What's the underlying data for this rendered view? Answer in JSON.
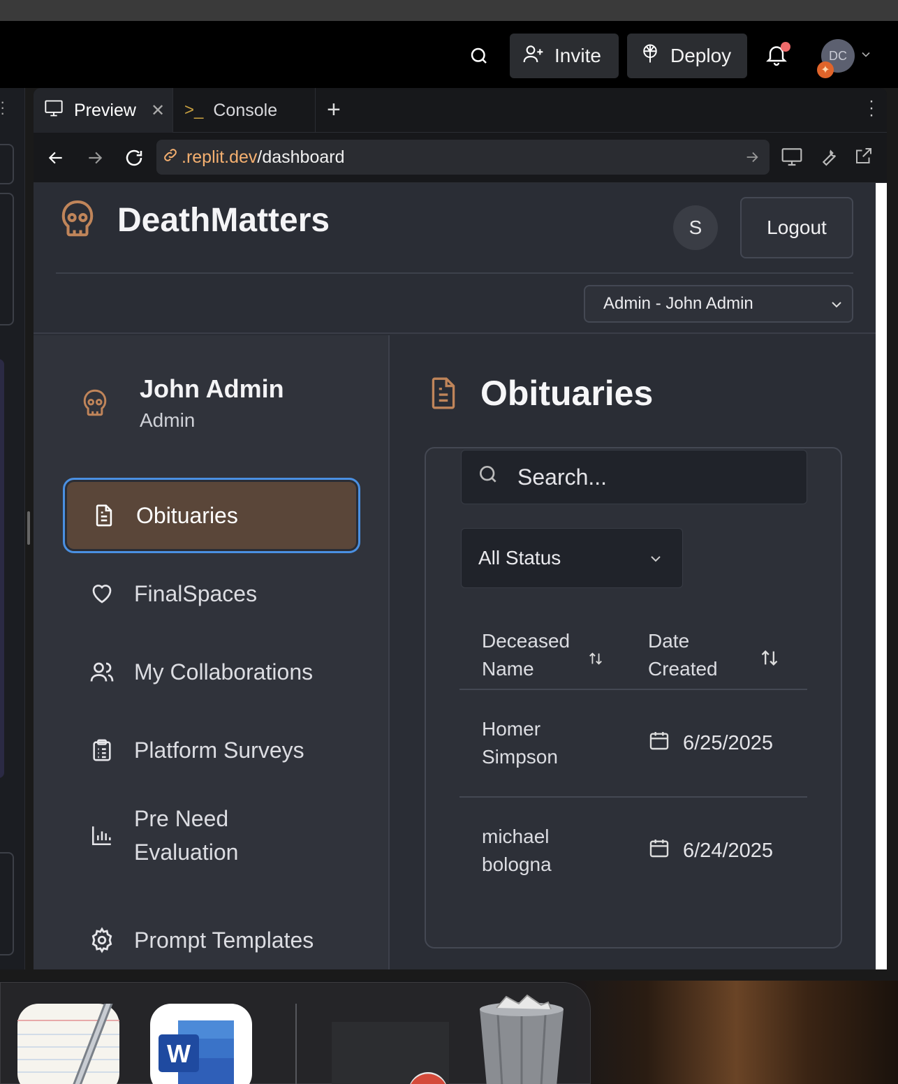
{
  "topbar": {
    "invite_label": "Invite",
    "deploy_label": "Deploy",
    "avatar_initials": "DC",
    "icons": [
      "search-icon",
      "user-plus-icon",
      "deploy-icon",
      "bell-icon",
      "chevron-down-icon"
    ]
  },
  "tabs": [
    {
      "label": "Preview",
      "icon": "monitor-icon",
      "active": true
    },
    {
      "label": "Console",
      "icon": "terminal-icon",
      "active": false
    }
  ],
  "url": {
    "domain": ".replit.dev",
    "path": "/dashboard"
  },
  "app": {
    "brand": "DeathMatters",
    "user_initial": "S",
    "logout_label": "Logout",
    "role_selected": "Admin - John Admin",
    "accent_color": "#5a4639",
    "focus_color": "#4a90e2",
    "icon_color": "#c0855a"
  },
  "sidebar": {
    "user_name": "John Admin",
    "user_role": "Admin",
    "items": [
      {
        "label": "Obituaries",
        "icon": "document-icon",
        "active": true
      },
      {
        "label": "FinalSpaces",
        "icon": "heart-icon",
        "active": false
      },
      {
        "label": "My Collaborations",
        "icon": "users-icon",
        "active": false
      },
      {
        "label": "Platform Surveys",
        "icon": "clipboard-icon",
        "active": false
      },
      {
        "label": "Pre Need Evaluation",
        "icon": "bar-chart-icon",
        "active": false
      },
      {
        "label": "Prompt Templates",
        "icon": "gear-icon",
        "active": false
      }
    ]
  },
  "main": {
    "title": "Obituaries",
    "search_placeholder": "Search...",
    "status_filter": "All Status",
    "columns": [
      "Deceased Name",
      "Date Created"
    ],
    "rows": [
      {
        "name": "Homer Simpson",
        "date": "6/25/2025"
      },
      {
        "name": "michael bologna",
        "date": "6/24/2025"
      }
    ]
  }
}
